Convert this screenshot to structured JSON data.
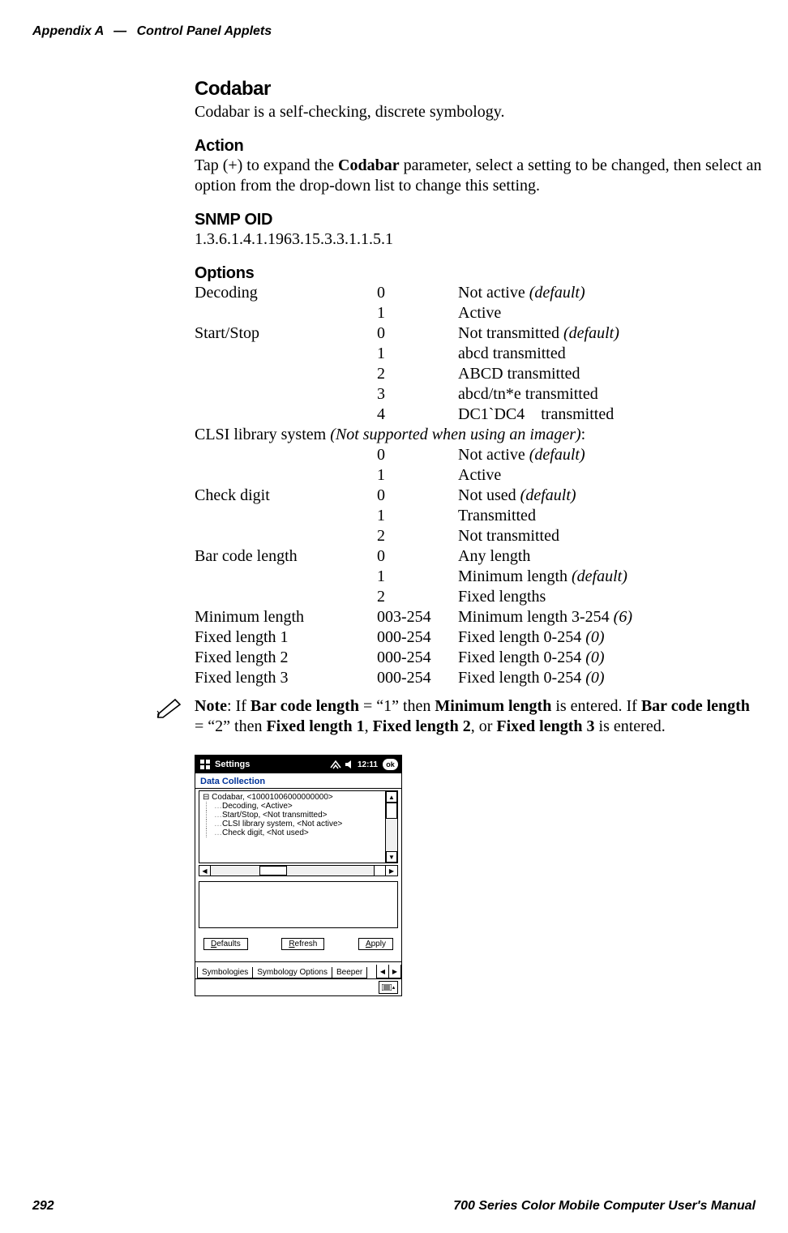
{
  "header": {
    "appendix": "Appendix",
    "appendix_letter": "A",
    "em_dash": "—",
    "section": "Control Panel Applets"
  },
  "h_codabar": "Codabar",
  "codabar_desc": "Codabar is a self-checking, discrete symbology.",
  "h_action": "Action",
  "action_pre": "Tap (+) to expand the ",
  "action_bold": "Codabar",
  "action_post": " parameter, select a setting to be changed, then select an option from the drop-down list to change this setting.",
  "h_snmp": "SNMP OID",
  "snmp_oid": "1.3.6.1.4.1.1963.15.3.3.1.1.5.1",
  "h_options": "Options",
  "clsi_line_pre": "CLSI library system ",
  "clsi_line_it": "(Not supported when using an imager)",
  "clsi_line_post": ":",
  "options_rows": [
    {
      "c1": "Decoding",
      "c2": "0",
      "c3": "Not active ",
      "c3_it": "(default)"
    },
    {
      "c1": "",
      "c2": "1",
      "c3": "Active",
      "c3_it": ""
    },
    {
      "c1": "Start/Stop",
      "c2": "0",
      "c3": "Not transmitted ",
      "c3_it": "(default)"
    },
    {
      "c1": "",
      "c2": "1",
      "c3": "abcd transmitted",
      "c3_it": ""
    },
    {
      "c1": "",
      "c2": "2",
      "c3": "ABCD transmitted",
      "c3_it": ""
    },
    {
      "c1": "",
      "c2": "3",
      "c3": "abcd/tn*e transmitted",
      "c3_it": ""
    },
    {
      "c1": "",
      "c2": "4",
      "c3": "DC1`DC4    transmitted",
      "c3_it": ""
    }
  ],
  "options_rows2": [
    {
      "c1": "",
      "c2": "0",
      "c3": "Not active ",
      "c3_it": "(default)"
    },
    {
      "c1": "",
      "c2": "1",
      "c3": "Active",
      "c3_it": ""
    },
    {
      "c1": "Check digit",
      "c2": "0",
      "c3": "Not used ",
      "c3_it": "(default)"
    },
    {
      "c1": "",
      "c2": "1",
      "c3": "Transmitted",
      "c3_it": ""
    },
    {
      "c1": "",
      "c2": "2",
      "c3": "Not transmitted",
      "c3_it": ""
    },
    {
      "c1": "Bar code length",
      "c2": "0",
      "c3": "Any length",
      "c3_it": ""
    },
    {
      "c1": "",
      "c2": "1",
      "c3": "Minimum length ",
      "c3_it": "(default)"
    },
    {
      "c1": "",
      "c2": "2",
      "c3": "Fixed lengths",
      "c3_it": ""
    },
    {
      "c1": "Minimum length",
      "c2": "003-254",
      "c3": "Minimum length 3-254 ",
      "c3_it": "(6)"
    },
    {
      "c1": "Fixed length 1",
      "c2": "000-254",
      "c3": "Fixed length 0-254 ",
      "c3_it": "(0)"
    },
    {
      "c1": "Fixed length 2",
      "c2": "000-254",
      "c3": "Fixed length 0-254 ",
      "c3_it": "(0)"
    },
    {
      "c1": "Fixed length 3",
      "c2": "000-254",
      "c3": "Fixed length 0-254 ",
      "c3_it": "(0)"
    }
  ],
  "note": {
    "lead": "Note",
    "p1": ": If ",
    "b1": "Bar code length",
    "p2": " = “1” then ",
    "b2": "Minimum length",
    "p3": " is entered. If ",
    "b3": "Bar code length",
    "p4": " = “2” then ",
    "b4": "Fixed length 1",
    "p5": ", ",
    "b5": "Fixed length 2",
    "p6": ", or ",
    "b6": "Fixed length 3",
    "p7": " is entered."
  },
  "pda": {
    "settings_label": "Settings",
    "clock": "12:11",
    "ok": "ok",
    "window_title": "Data Collection",
    "tree_root": "Codabar, <10001006000000000>",
    "tree_items": [
      "Decoding, <Active>",
      "Start/Stop, <Not transmitted>",
      "CLSI library system, <Not active>",
      "Check digit, <Not used>"
    ],
    "btn_defaults_u": "D",
    "btn_defaults_rest": "efaults",
    "btn_refresh_u": "R",
    "btn_refresh_rest": "efresh",
    "btn_apply_u": "A",
    "btn_apply_rest": "pply",
    "tab1": "Symbologies",
    "tab2": "Symbology Options",
    "tab3": "Beeper"
  },
  "footer": {
    "page": "292",
    "manual": "700 Series Color Mobile Computer User's Manual"
  }
}
